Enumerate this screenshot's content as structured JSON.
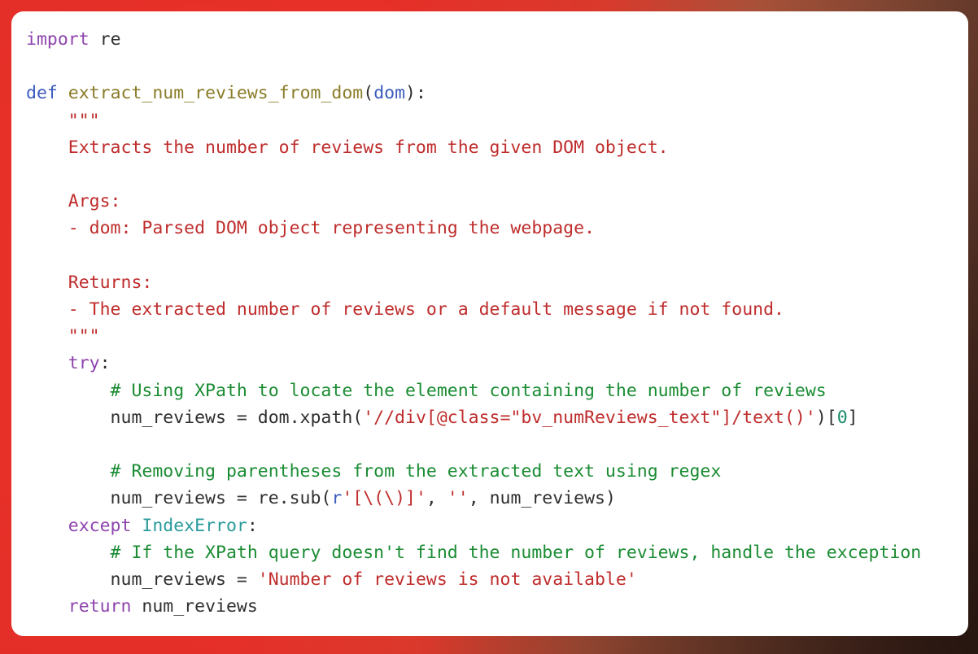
{
  "theme": {
    "background_left": "#e02d28",
    "background_right": "#36201a",
    "card_background": "#ffffff",
    "keyword_color": "#8e44ad",
    "def_color": "#3b5bbd",
    "function_name_color": "#8a7c28",
    "docstring_color": "#bf2c2c",
    "string_color": "#bf2c2c",
    "comment_color": "#1a8c33",
    "builtin_color": "#2a9a9a",
    "number_color": "#1a8c6a",
    "plain_text_color": "#2f2f2f"
  },
  "code": {
    "language": "python",
    "line_count": 22,
    "lines": [
      {
        "n": 1,
        "tokens": [
          {
            "t": "import",
            "c": "kw"
          },
          {
            "t": " ",
            "c": "plain"
          },
          {
            "t": "re",
            "c": "plain"
          }
        ]
      },
      {
        "n": 2,
        "tokens": []
      },
      {
        "n": 3,
        "tokens": [
          {
            "t": "def",
            "c": "def"
          },
          {
            "t": " ",
            "c": "plain"
          },
          {
            "t": "extract_num_reviews_from_dom",
            "c": "fn"
          },
          {
            "t": "(",
            "c": "punct"
          },
          {
            "t": "dom",
            "c": "param"
          },
          {
            "t": "):",
            "c": "punct"
          }
        ]
      },
      {
        "n": 4,
        "tokens": [
          {
            "t": "    \"\"\"",
            "c": "doc"
          }
        ]
      },
      {
        "n": 5,
        "tokens": [
          {
            "t": "    Extracts the number of reviews from the given DOM object.",
            "c": "doc"
          }
        ]
      },
      {
        "n": 6,
        "tokens": []
      },
      {
        "n": 7,
        "tokens": [
          {
            "t": "    Args:",
            "c": "doc"
          }
        ]
      },
      {
        "n": 8,
        "tokens": [
          {
            "t": "    - dom: Parsed DOM object representing the webpage.",
            "c": "doc"
          }
        ]
      },
      {
        "n": 9,
        "tokens": []
      },
      {
        "n": 10,
        "tokens": [
          {
            "t": "    Returns:",
            "c": "doc"
          }
        ]
      },
      {
        "n": 11,
        "tokens": [
          {
            "t": "    - The extracted number of reviews or a default message if not found.",
            "c": "doc"
          }
        ]
      },
      {
        "n": 12,
        "tokens": [
          {
            "t": "    \"\"\"",
            "c": "doc"
          }
        ]
      },
      {
        "n": 13,
        "tokens": [
          {
            "t": "    ",
            "c": "plain"
          },
          {
            "t": "try",
            "c": "kw"
          },
          {
            "t": ":",
            "c": "punct"
          }
        ]
      },
      {
        "n": 14,
        "tokens": [
          {
            "t": "        # Using XPath to locate the element containing the number of reviews",
            "c": "comment"
          }
        ]
      },
      {
        "n": 15,
        "tokens": [
          {
            "t": "        num_reviews = dom.xpath(",
            "c": "plain"
          },
          {
            "t": "'//div[@class=\"bv_numReviews_text\"]/text()'",
            "c": "str"
          },
          {
            "t": ")[",
            "c": "punct"
          },
          {
            "t": "0",
            "c": "num"
          },
          {
            "t": "]",
            "c": "punct"
          }
        ]
      },
      {
        "n": 16,
        "tokens": []
      },
      {
        "n": 17,
        "tokens": [
          {
            "t": "        # Removing parentheses from the extracted text using regex",
            "c": "comment"
          }
        ]
      },
      {
        "n": 18,
        "tokens": [
          {
            "t": "        num_reviews = re.sub(",
            "c": "plain"
          },
          {
            "t": "r",
            "c": "param"
          },
          {
            "t": "'[\\(\\)]'",
            "c": "str"
          },
          {
            "t": ", ",
            "c": "punct"
          },
          {
            "t": "''",
            "c": "str"
          },
          {
            "t": ", num_reviews)",
            "c": "plain"
          }
        ]
      },
      {
        "n": 19,
        "tokens": [
          {
            "t": "    ",
            "c": "plain"
          },
          {
            "t": "except",
            "c": "kw"
          },
          {
            "t": " ",
            "c": "plain"
          },
          {
            "t": "IndexError",
            "c": "builtin"
          },
          {
            "t": ":",
            "c": "punct"
          }
        ]
      },
      {
        "n": 20,
        "tokens": [
          {
            "t": "        # If the XPath query doesn't find the number of reviews, handle the exception",
            "c": "comment"
          }
        ]
      },
      {
        "n": 21,
        "tokens": [
          {
            "t": "        num_reviews = ",
            "c": "plain"
          },
          {
            "t": "'Number of reviews is not available'",
            "c": "str"
          }
        ]
      },
      {
        "n": 22,
        "tokens": [
          {
            "t": "    ",
            "c": "plain"
          },
          {
            "t": "return",
            "c": "kw"
          },
          {
            "t": " ",
            "c": "plain"
          },
          {
            "t": "num_reviews",
            "c": "plain"
          }
        ]
      }
    ]
  }
}
